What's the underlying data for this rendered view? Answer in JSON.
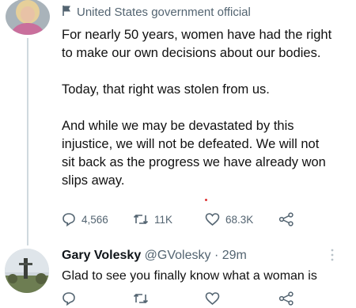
{
  "tweet": {
    "badge_label": "United States government official",
    "paragraphs": [
      "For nearly 50 years, women have had the right to make our own decisions about our bodies.",
      "Today, that right was stolen from us.",
      "And while we may be devastated by this injustice, we will not be defeated. We will not sit back as the progress we have already won slips away."
    ],
    "actions": {
      "reply_count": "4,566",
      "retweet_count": "11K",
      "like_count": "68.3K"
    }
  },
  "reply": {
    "name": "Gary Volesky",
    "handle": "@GVolesky",
    "separator": "·",
    "time": "29m",
    "text": "Glad to see you finally know what a woman is"
  },
  "icons": {
    "flag": "flag-icon",
    "reply": "reply-icon",
    "retweet": "retweet-icon",
    "like": "heart-icon",
    "share": "share-icon",
    "more": "more-icon"
  },
  "colors": {
    "secondary_text": "#536471",
    "thread_line": "#cfd9de",
    "body_text": "#111111"
  }
}
